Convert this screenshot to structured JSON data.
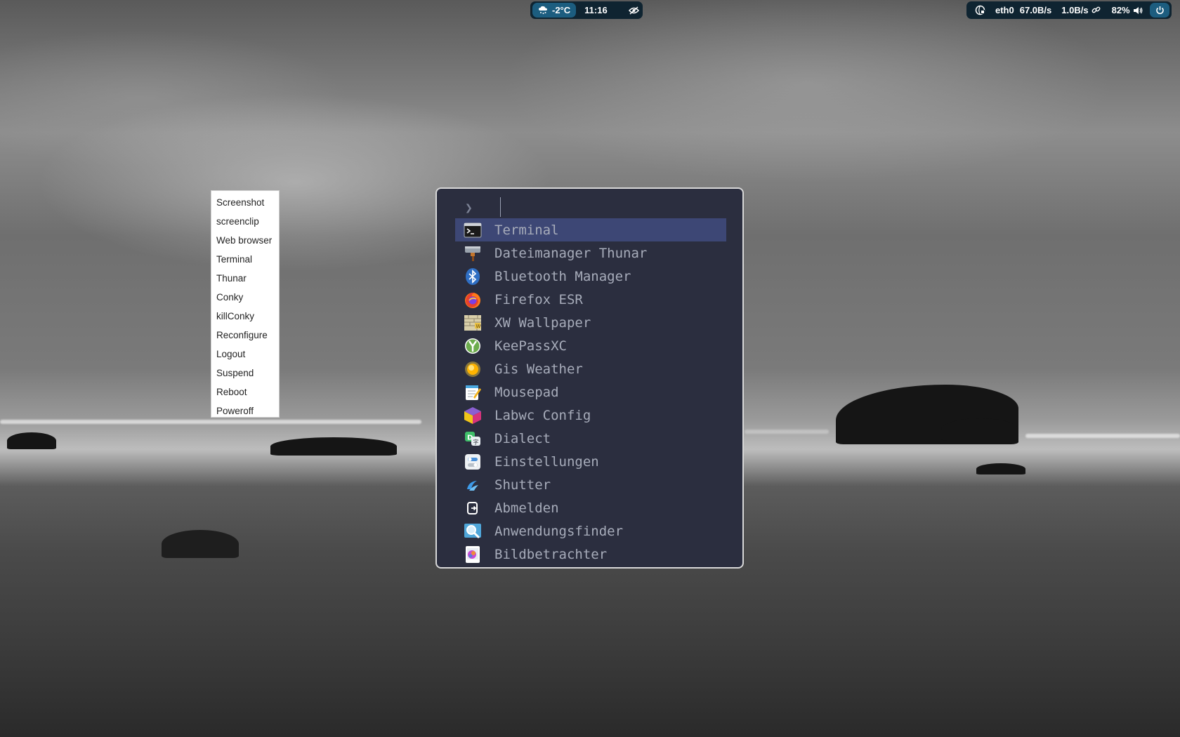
{
  "topbar": {
    "weather": {
      "icon": "snow-cloud-icon",
      "temperature": "-2°C"
    },
    "clock": "11:16",
    "idle_inhibitor": {
      "icon": "eye-slash-icon"
    },
    "network": {
      "icon": "network-icon",
      "interface": "eth0",
      "down": "67.0B/s",
      "up": "1.0B/s",
      "link_icon": "link-icon"
    },
    "volume": {
      "level": "82%",
      "icon": "speaker-icon"
    },
    "power": {
      "icon": "power-icon"
    },
    "colors": {
      "pill_bg": "#0f2431",
      "accent": "#1c5d7f"
    }
  },
  "context_menu": {
    "items": [
      "Screenshot",
      "screenclip",
      "Web browser",
      "Terminal",
      "Thunar",
      "Conky",
      "killConky",
      "Reconfigure",
      "Logout",
      "Suspend",
      "Reboot",
      "Poweroff"
    ]
  },
  "launcher": {
    "prompt": "❯",
    "query": "",
    "selected_index": 0,
    "colors": {
      "background": "#2b2e3f",
      "selection": "#3d4775",
      "text": "#a7acba"
    },
    "apps": [
      {
        "label": "Terminal",
        "icon": "terminal-icon"
      },
      {
        "label": "Dateimanager Thunar",
        "icon": "file-manager-icon"
      },
      {
        "label": "Bluetooth Manager",
        "icon": "bluetooth-icon"
      },
      {
        "label": "Firefox ESR",
        "icon": "firefox-icon"
      },
      {
        "label": "XW Wallpaper",
        "icon": "wallpaper-icon"
      },
      {
        "label": "KeePassXC",
        "icon": "keepass-icon"
      },
      {
        "label": "Gis Weather",
        "icon": "sun-icon"
      },
      {
        "label": "Mousepad",
        "icon": "notepad-icon"
      },
      {
        "label": "Labwc Config",
        "icon": "labwc-icon"
      },
      {
        "label": "Dialect",
        "icon": "translate-icon"
      },
      {
        "label": "Einstellungen",
        "icon": "settings-icon"
      },
      {
        "label": "Shutter",
        "icon": "shutter-icon"
      },
      {
        "label": "Abmelden",
        "icon": "logout-icon"
      },
      {
        "label": "Anwendungsfinder",
        "icon": "app-finder-icon"
      },
      {
        "label": "Bildbetrachter",
        "icon": "image-viewer-icon"
      }
    ]
  }
}
